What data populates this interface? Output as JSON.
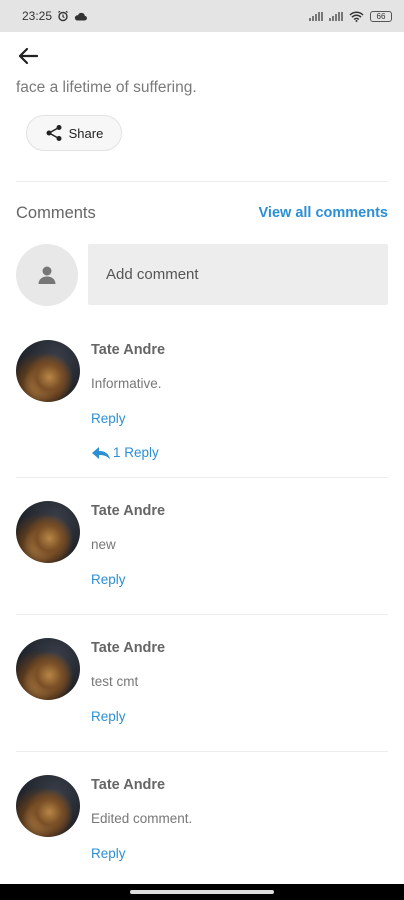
{
  "status_bar": {
    "time": "23:25",
    "alarm_icon": "alarm-icon",
    "cloud_icon": "cloud-icon",
    "battery": "66"
  },
  "header": {
    "back_icon": "back-arrow-icon"
  },
  "article": {
    "snippet": "face a lifetime of suffering."
  },
  "share": {
    "label": "Share",
    "icon": "share-icon"
  },
  "comments": {
    "title": "Comments",
    "view_all": "View all comments",
    "add_placeholder": "Add comment",
    "items": [
      {
        "author": "Tate Andre",
        "text": "Informative.",
        "reply": "Reply",
        "replies": "1 Reply"
      },
      {
        "author": "Tate Andre",
        "text": "new",
        "reply": "Reply"
      },
      {
        "author": "Tate Andre",
        "text": "test cmt",
        "reply": "Reply"
      },
      {
        "author": "Tate Andre",
        "text": "Edited comment.",
        "reply": "Reply"
      }
    ]
  },
  "colors": {
    "accent": "#2c8fd6",
    "status_bar": "#e4e4e4"
  }
}
